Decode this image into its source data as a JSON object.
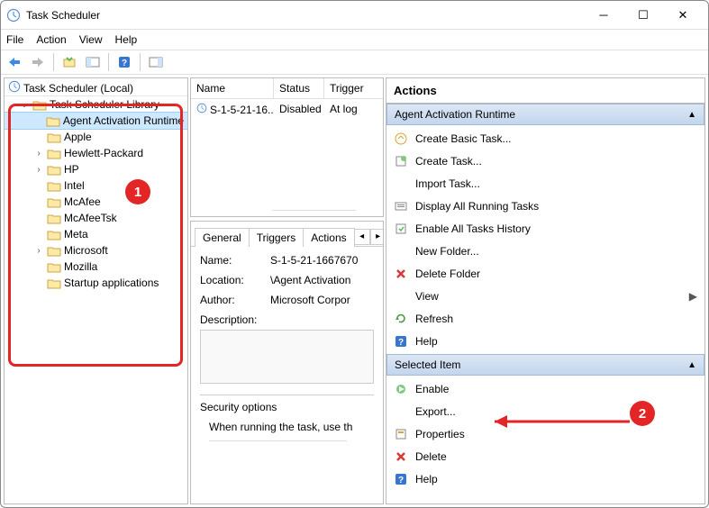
{
  "window_title": "Task Scheduler",
  "menubar": {
    "file": "File",
    "action": "Action",
    "view": "View",
    "help": "Help"
  },
  "tree": {
    "root": "Task Scheduler (Local)",
    "library": "Task Scheduler Library",
    "items": [
      {
        "label": "Agent Activation Runtime",
        "selected": true,
        "expandable": false
      },
      {
        "label": "Apple",
        "selected": false,
        "expandable": false
      },
      {
        "label": "Hewlett-Packard",
        "selected": false,
        "expandable": true
      },
      {
        "label": "HP",
        "selected": false,
        "expandable": true
      },
      {
        "label": "Intel",
        "selected": false,
        "expandable": false
      },
      {
        "label": "McAfee",
        "selected": false,
        "expandable": false
      },
      {
        "label": "McAfeeTsk",
        "selected": false,
        "expandable": false
      },
      {
        "label": "Meta",
        "selected": false,
        "expandable": false
      },
      {
        "label": "Microsoft",
        "selected": false,
        "expandable": true
      },
      {
        "label": "Mozilla",
        "selected": false,
        "expandable": false
      },
      {
        "label": "Startup applications",
        "selected": false,
        "expandable": false
      }
    ]
  },
  "task_columns": {
    "name": "Name",
    "status": "Status",
    "triggers": "Trigger"
  },
  "task_row": {
    "name": "S-1-5-21-16...",
    "status": "Disabled",
    "triggers": "At log"
  },
  "tabs": {
    "general": "General",
    "triggers": "Triggers",
    "actions": "Actions"
  },
  "details": {
    "name_lbl": "Name:",
    "name_val": "S-1-5-21-1667670",
    "location_lbl": "Location:",
    "location_val": "\\Agent Activation",
    "author_lbl": "Author:",
    "author_val": "Microsoft Corpor",
    "description_lbl": "Description:",
    "security_header": "Security options",
    "security_text": "When running the task, use th"
  },
  "actions": {
    "header": "Actions",
    "group1": "Agent Activation Runtime",
    "items1": [
      "Create Basic Task...",
      "Create Task...",
      "Import Task...",
      "Display All Running Tasks",
      "Enable All Tasks History",
      "New Folder...",
      "Delete Folder",
      "View",
      "Refresh",
      "Help"
    ],
    "group2": "Selected Item",
    "items2": [
      "Enable",
      "Export...",
      "Properties",
      "Delete",
      "Help"
    ]
  },
  "annotations": {
    "badge1": "1",
    "badge2": "2"
  }
}
